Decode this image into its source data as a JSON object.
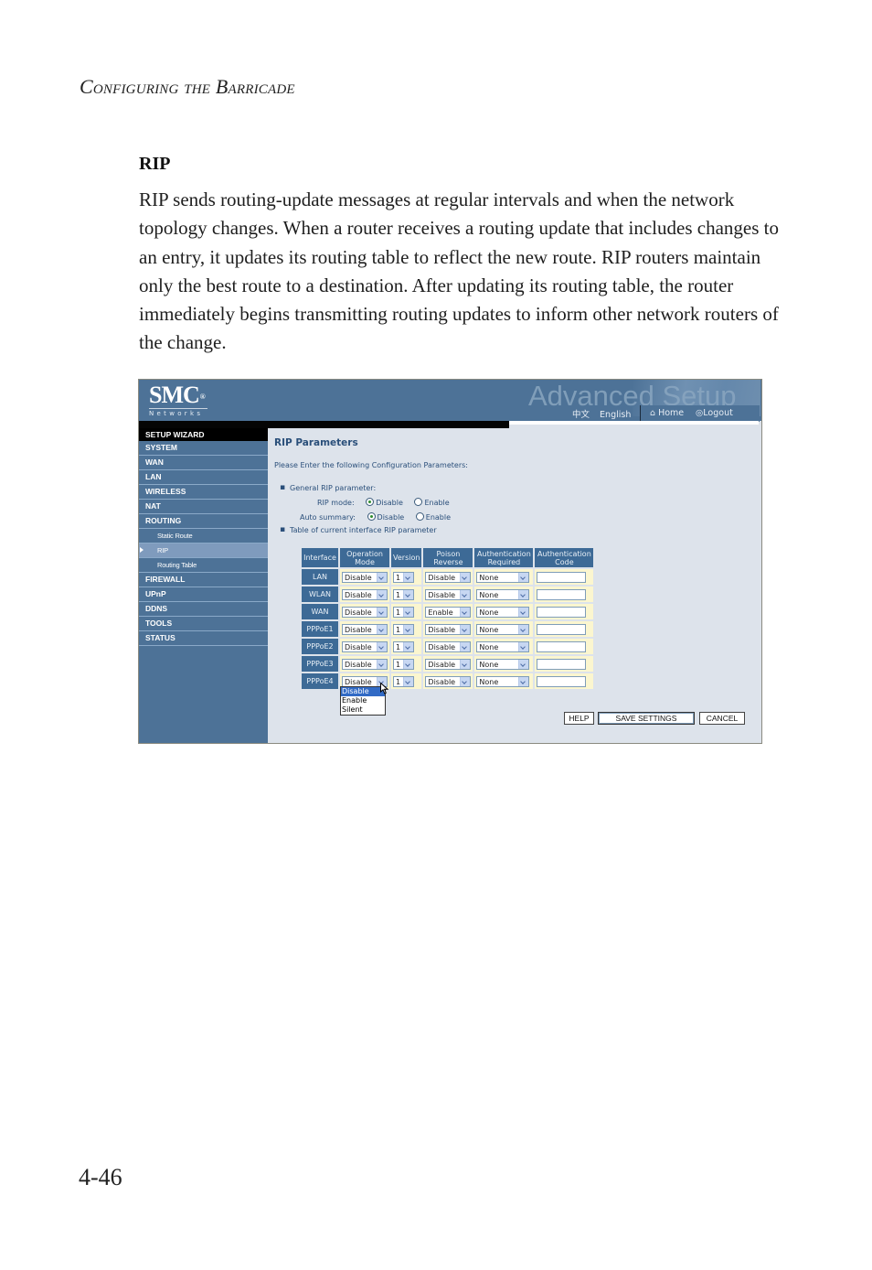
{
  "running_head": "Configuring the Barricade",
  "section_title": "RIP",
  "body_paragraph": "RIP sends routing-update messages at regular intervals and when the network topology changes. When a router receives a routing update that includes changes to an entry, it updates its routing table to reflect the new route. RIP routers maintain only the best route to a destination. After updating its routing table, the router immediately begins transmitting routing updates to inform other network routers of the change.",
  "page_number": "4-46",
  "screenshot": {
    "logo": {
      "brand": "SMC",
      "registered": "®",
      "tagline": "Networks"
    },
    "header_title": "Advanced Setup",
    "language_links": [
      "中文",
      "English"
    ],
    "top_links": {
      "home": "Home",
      "logout": "Logout"
    },
    "sidebar": {
      "items": [
        {
          "label": "SETUP WIZARD",
          "type": "wizard"
        },
        {
          "label": "SYSTEM",
          "type": "main"
        },
        {
          "label": "WAN",
          "type": "main"
        },
        {
          "label": "LAN",
          "type": "main"
        },
        {
          "label": "WIRELESS",
          "type": "main"
        },
        {
          "label": "NAT",
          "type": "main"
        },
        {
          "label": "ROUTING",
          "type": "main"
        },
        {
          "label": "Static Route",
          "type": "sub"
        },
        {
          "label": "RIP",
          "type": "sub",
          "active": true
        },
        {
          "label": "Routing Table",
          "type": "sub"
        },
        {
          "label": "FIREWALL",
          "type": "main"
        },
        {
          "label": "UPnP",
          "type": "main"
        },
        {
          "label": "DDNS",
          "type": "main"
        },
        {
          "label": "TOOLS",
          "type": "main"
        },
        {
          "label": "STATUS",
          "type": "main"
        }
      ]
    },
    "content": {
      "title": "RIP Parameters",
      "intro": "Please Enter the following Configuration Parameters:",
      "general_label": "General RIP parameter:",
      "rip_mode": {
        "label": "RIP mode:",
        "options": [
          "Disable",
          "Enable"
        ],
        "selected": "Disable"
      },
      "auto_summary": {
        "label": "Auto summary:",
        "options": [
          "Disable",
          "Enable"
        ],
        "selected": "Disable"
      },
      "table_label": "Table of current interface RIP parameter",
      "table": {
        "headers": [
          "Interface",
          "Operation Mode",
          "Version",
          "Poison Reverse",
          "Authentication Required",
          "Authentication Code"
        ],
        "rows": [
          {
            "interface": "LAN",
            "operation_mode": "Disable",
            "version": "1",
            "poison_reverse": "Disable",
            "auth_required": "None",
            "auth_code": ""
          },
          {
            "interface": "WLAN",
            "operation_mode": "Disable",
            "version": "1",
            "poison_reverse": "Disable",
            "auth_required": "None",
            "auth_code": ""
          },
          {
            "interface": "WAN",
            "operation_mode": "Disable",
            "version": "1",
            "poison_reverse": "Enable",
            "auth_required": "None",
            "auth_code": ""
          },
          {
            "interface": "PPPoE1",
            "operation_mode": "Disable",
            "version": "1",
            "poison_reverse": "Disable",
            "auth_required": "None",
            "auth_code": ""
          },
          {
            "interface": "PPPoE2",
            "operation_mode": "Disable",
            "version": "1",
            "poison_reverse": "Disable",
            "auth_required": "None",
            "auth_code": ""
          },
          {
            "interface": "PPPoE3",
            "operation_mode": "Disable",
            "version": "1",
            "poison_reverse": "Disable",
            "auth_required": "None",
            "auth_code": ""
          },
          {
            "interface": "PPPoE4",
            "operation_mode": "Disable",
            "version": "1",
            "poison_reverse": "Disable",
            "auth_required": "None",
            "auth_code": ""
          }
        ]
      },
      "open_dropdown": {
        "options": [
          "Disable",
          "Enable",
          "Silent"
        ],
        "highlighted": "Disable"
      },
      "buttons": {
        "help": "HELP",
        "save": "SAVE SETTINGS",
        "cancel": "CANCEL"
      }
    },
    "colors": {
      "topbar": "#4d7297",
      "sidebar": "#4d7297",
      "content_bg": "#dde3eb",
      "header_cell": "#3d6a96",
      "cell_bg": "#fbf6cf",
      "title_text": "#2a4f7a",
      "highlight": "#316ac5"
    }
  }
}
